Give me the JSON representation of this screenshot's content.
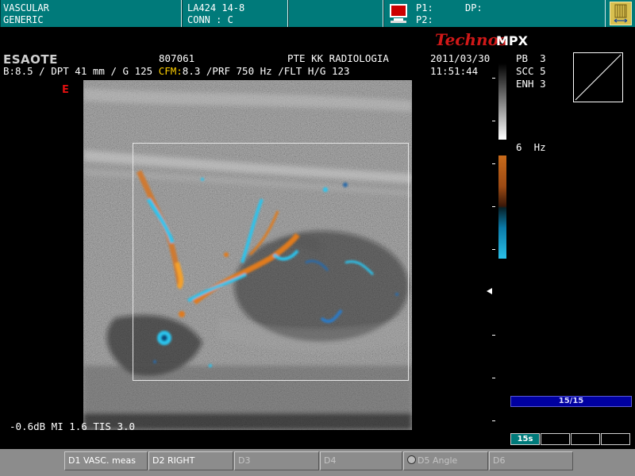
{
  "topbar": {
    "app": "VASCULAR",
    "preset": "GENERIC",
    "probe": "LA424 14-8",
    "connector": "CONN : C",
    "p1": "P1:",
    "p2": "P2:",
    "dp": "DP:"
  },
  "branding": {
    "manufacturer": "ESAOTE",
    "technos": "Technos",
    "mpx": "MPX"
  },
  "header": {
    "patient_id": "807061",
    "institution": "PTE KK RADIOLOGIA",
    "date": "2011/03/30",
    "time": "11:51:44",
    "imaging_params": "B:8.5 / DPT 41 mm / G 125",
    "cfm_label": "CFM:",
    "cfm_params": "8.3 /PRF 750 Hz /FLT H/G 123"
  },
  "settings": {
    "pb": "PB  3",
    "scc": "SCC 5",
    "enh": "ENH 3",
    "scale": "6  Hz"
  },
  "image": {
    "marker": "E",
    "acoustic_output": "-0.6dB MI 1.6 TIS 3.0"
  },
  "cine": {
    "frames": "15/15",
    "frames_fraction": 1.0,
    "duration": "15s"
  },
  "softkeys": [
    {
      "label": "D1 VASC. meas",
      "enabled": true
    },
    {
      "label": "D2 RIGHT",
      "enabled": true
    },
    {
      "label": "D3",
      "enabled": false
    },
    {
      "label": "D4",
      "enabled": false
    },
    {
      "label": "D5 Angle",
      "enabled": false
    },
    {
      "label": "D6",
      "enabled": false
    }
  ],
  "colors": {
    "topbar": "#007a7a",
    "cfm_label": "#ffd000",
    "brand_red": "#d01818",
    "doppler_red": "#c86a1a",
    "doppler_blue": "#2ac0e8"
  },
  "icons": [
    "monitor-icon",
    "film-icon",
    "body-marker-icon",
    "focus-arrow-icon"
  ]
}
